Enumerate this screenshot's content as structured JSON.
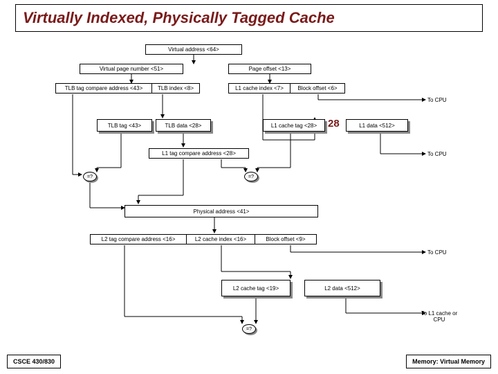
{
  "title": "Virtually Indexed, Physically Tagged Cache",
  "footer_left": "CSCE 430/830",
  "footer_right": "Memory: Virtual Memory",
  "annotation": "28",
  "labels": {
    "virtual_address": "Virtual address <64>",
    "vpn": "Virtual page number <51>",
    "page_offset": "Page offset <13>",
    "tlb_tag_compare": "TLB tag compare address <43>",
    "tlb_index": "TLB index <8>",
    "l1_cache_index": "L1 cache index <7>",
    "block_offset_l1": "Block offset <6>",
    "tlb_tag": "TLB tag <43>",
    "tlb_data": "TLB data <28>",
    "l1_cache_tag": "L1 cache tag <28>",
    "l1_data": "L1 data <512>",
    "l1_tag_compare": "L1 tag compare address <28>",
    "physical_address": "Physical address <41>",
    "l2_tag_compare": "L2 tag compare address <16>",
    "l2_cache_index": "L2 cache index <16>",
    "block_offset_l2": "Block offset <9>",
    "l2_cache_tag": "L2 cache tag <19>",
    "l2_data": "L2 data <512>",
    "to_cpu": "To CPU",
    "to_l1_or_cpu": "To L1 cache or CPU",
    "comp": "=?"
  },
  "chart_data": {
    "type": "flow",
    "virtual_address_bits": 64,
    "virtual_page_number_bits": 51,
    "page_offset_bits": 13,
    "tlb_tag_compare_bits": 43,
    "tlb_index_bits": 8,
    "l1_cache_index_bits": 7,
    "l1_block_offset_bits": 6,
    "tlb_tag_bits": 43,
    "tlb_data_bits": 28,
    "l1_cache_tag_bits": 28,
    "l1_data_bits": 512,
    "l1_tag_compare_bits": 28,
    "physical_address_bits": 41,
    "l2_tag_compare_bits": 16,
    "l2_cache_index_bits": 16,
    "l2_block_offset_bits": 9,
    "l2_cache_tag_bits": 19,
    "l2_data_bits": 512,
    "outputs": [
      "To CPU",
      "To CPU",
      "To CPU",
      "To L1 cache or CPU"
    ]
  }
}
